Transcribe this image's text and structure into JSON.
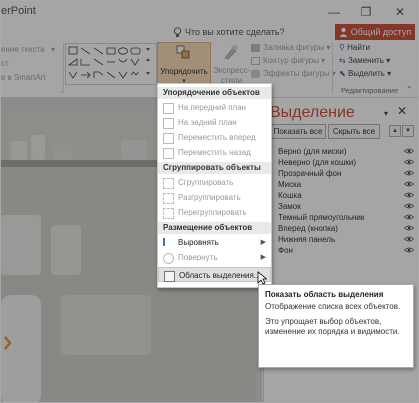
{
  "app": {
    "title": "erPoint",
    "minimize": "—",
    "restore": "❐",
    "close": "✕"
  },
  "tellme": {
    "placeholder": "Что вы хотите сделать?"
  },
  "share": {
    "label": "Общий доступ"
  },
  "ribbon": {
    "text_dir": "ение текста",
    "align_text": "ст",
    "smartart": "в в SmartArt",
    "arrange_label": "Упорядочить",
    "express_label1": "Экспресс-",
    "express_label2": "стили",
    "fill": "Заливка фигуры",
    "outline": "Контур фигуры",
    "effects": "Эффекты фигуры",
    "find": "Найти",
    "replace": "Заменить",
    "select": "Выделить",
    "editing_group": "Редактирование"
  },
  "menu": {
    "sections": {
      "order": "Упорядочение объектов",
      "group": "Сгруппировать объекты",
      "place": "Размещение объектов"
    },
    "items": {
      "front": "На передний план",
      "back": "На задний план",
      "forward": "Переместить вперед",
      "backward": "Переместить назад",
      "group": "Сгруппировать",
      "ungroup": "Разгруппировать",
      "regroup": "Перегруппировать",
      "align": "Выровнять",
      "rotate": "Повернуть",
      "selection_pane": "Область выделения..."
    }
  },
  "pane": {
    "title": "Выделение",
    "show_all": "Показать все",
    "hide_all": "Скрыть все",
    "objects": [
      "Верно (для миски)",
      "Неверно (для кошки)",
      "Прозрачный фон",
      "Миска",
      "Кошка",
      "Замок",
      "Темный прямоугольник",
      "Вперед (кнопка)",
      "Нижняя панель",
      "Фон"
    ]
  },
  "tooltip": {
    "title": "Показать область выделения",
    "line1": "Отображение списка всех объектов.",
    "line2": "Это упрощает выбор объектов, изменение их порядка и видимости."
  },
  "colors": {
    "accent": "#c8412a",
    "arrange_bg": "#f8d9b6"
  }
}
